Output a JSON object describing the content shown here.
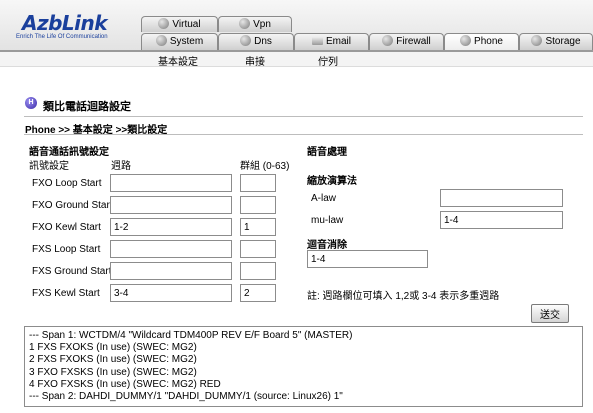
{
  "brand": {
    "name": "AzbLink",
    "slogan": "Enrich The Life Of Communication"
  },
  "tabs_top": [
    {
      "label": "Virtual",
      "icon": "globe-icon"
    },
    {
      "label": "Vpn",
      "icon": "globe-icon"
    }
  ],
  "tabs_main": [
    {
      "label": "System",
      "icon": "globe-icon"
    },
    {
      "label": "Dns",
      "icon": "globe-icon"
    },
    {
      "label": "Email",
      "icon": "mail-icon"
    },
    {
      "label": "Firewall",
      "icon": "globe-icon"
    },
    {
      "label": "Phone",
      "icon": "globe-icon",
      "active": true
    },
    {
      "label": "Storage",
      "icon": "globe-icon"
    }
  ],
  "subnav": [
    "基本設定",
    "串接",
    "佇列"
  ],
  "page": {
    "title": "類比電話迴路設定",
    "breadcrumb": "Phone >> 基本設定 >>類比設定"
  },
  "signaling": {
    "section_title": "語音通話訊號設定",
    "col_signal": "訊號設定",
    "col_port": "週路",
    "col_group": "群組 (0-63)",
    "rows": [
      {
        "label": "FXO Loop Start",
        "port": "",
        "group": ""
      },
      {
        "label": "FXO Ground Start",
        "port": "",
        "group": ""
      },
      {
        "label": "FXO Kewl Start",
        "port": "1-2",
        "group": "1"
      },
      {
        "label": "FXS Loop Start",
        "port": "",
        "group": ""
      },
      {
        "label": "FXS Ground Start",
        "port": "",
        "group": ""
      },
      {
        "label": "FXS Kewl Start",
        "port": "3-4",
        "group": "2"
      }
    ]
  },
  "voice": {
    "section_title": "語音處理",
    "compand_title": "縮放演算法",
    "alaw_label": "A-law",
    "alaw_value": "",
    "mulaw_label": "mu-law",
    "mulaw_value": "1-4",
    "echo_title": "迴音消除",
    "echo_value": "1-4",
    "note": "註: 週路欄位可填入 1,2或 3-4 表示多重週路"
  },
  "send_label": "送交",
  "log_lines": [
    "--- Span 1: WCTDM/4 \"Wildcard TDM400P REV E/F Board 5\" (MASTER)",
    "1 FXS FXOKS (In use) (SWEC: MG2)",
    "2 FXS FXOKS (In use) (SWEC: MG2)",
    "3 FXO FXSKS (In use) (SWEC: MG2)",
    "4 FXO FXSKS (In use) (SWEC: MG2) RED",
    "--- Span 2: DAHDI_DUMMY/1 \"DAHDI_DUMMY/1 (source: Linux26) 1\""
  ]
}
